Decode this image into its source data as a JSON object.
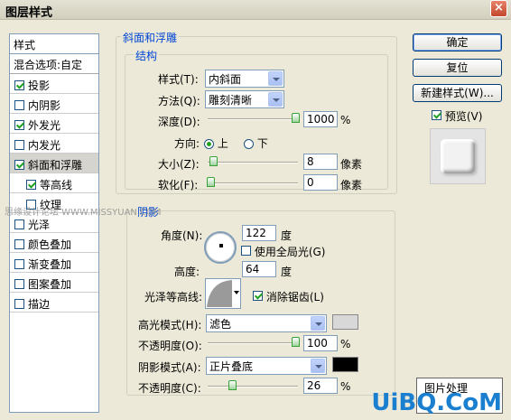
{
  "window": {
    "title": "图层样式",
    "close": "×"
  },
  "left": {
    "header": "样式",
    "blend": "混合选项:自定",
    "items": [
      {
        "label": "投影",
        "checked": true
      },
      {
        "label": "内阴影",
        "checked": false
      },
      {
        "label": "外发光",
        "checked": true
      },
      {
        "label": "内发光",
        "checked": false
      },
      {
        "label": "斜面和浮雕",
        "checked": true,
        "selected": true
      },
      {
        "label": "等高线",
        "checked": true,
        "sub": true
      },
      {
        "label": "纹理",
        "checked": false,
        "sub": true
      },
      {
        "label": "光泽",
        "checked": false
      },
      {
        "label": "颜色叠加",
        "checked": false
      },
      {
        "label": "渐变叠加",
        "checked": false
      },
      {
        "label": "图案叠加",
        "checked": false
      },
      {
        "label": "描边",
        "checked": false
      }
    ]
  },
  "bevel": {
    "group_title": "斜面和浮雕",
    "struct_title": "结构",
    "style_label": "样式(T):",
    "style_value": "内斜面",
    "method_label": "方法(Q):",
    "method_value": "雕刻清晰",
    "depth_label": "深度(D):",
    "depth_value": "1000",
    "depth_unit": "%",
    "depth_level": 1.0,
    "direction_label": "方向:",
    "dir_up": "上",
    "dir_down": "下",
    "size_label": "大小(Z):",
    "size_value": "8",
    "size_unit": "像素",
    "size_level": 0.03,
    "soften_label": "软化(F):",
    "soften_value": "0",
    "soften_unit": "像素",
    "soften_level": 0.0
  },
  "shading": {
    "title": "阴影",
    "angle_label": "角度(N):",
    "angle_value": "122",
    "angle_unit": "度",
    "global_light": "使用全局光(G)",
    "altitude_label": "高度:",
    "altitude_value": "64",
    "altitude_unit": "度",
    "gloss_label": "光泽等高线:",
    "antialias": "消除锯齿(L)",
    "hl_mode_label": "高光模式(H):",
    "hl_mode_value": "滤色",
    "hl_color": "#d8d8d8",
    "hl_opacity_label": "不透明度(O):",
    "hl_opacity_value": "100",
    "hl_opacity_unit": "%",
    "hl_level": 1.0,
    "sh_mode_label": "阴影模式(A):",
    "sh_mode_value": "正片叠底",
    "sh_color": "#000000",
    "sh_opacity_label": "不透明度(C):",
    "sh_opacity_value": "26",
    "sh_opacity_unit": "%",
    "sh_level": 0.26
  },
  "buttons": {
    "ok": "确定",
    "reset": "复位",
    "new_style": "新建样式(W)...",
    "preview": "预览(V)"
  },
  "watermark": {
    "left": "思缘设计论坛 WWW.MISSYUAN.COM",
    "right": "UiBQ.CoM",
    "bottom_partial": "图片处理"
  }
}
